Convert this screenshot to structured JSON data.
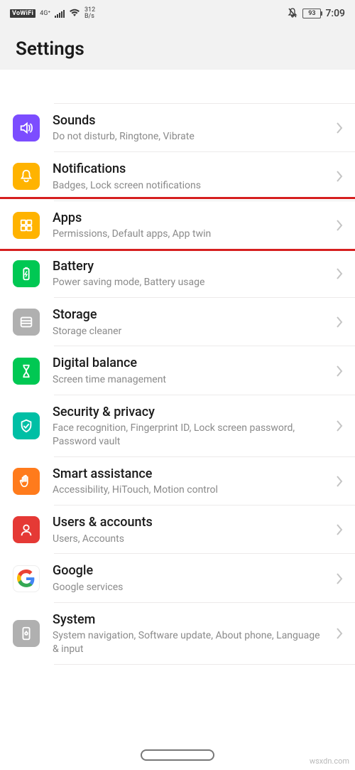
{
  "status": {
    "vowifi": "VoWiFi",
    "net_top": "4G⁺",
    "speed_top": "312",
    "speed_bottom": "B/s",
    "battery": "93",
    "time": "7:09"
  },
  "header": {
    "title": "Settings"
  },
  "rows": [
    {
      "id": "sounds",
      "title": "Sounds",
      "sub": "Do not disturb, Ringtone, Vibrate"
    },
    {
      "id": "notifications",
      "title": "Notifications",
      "sub": "Badges, Lock screen notifications"
    },
    {
      "id": "apps",
      "title": "Apps",
      "sub": "Permissions, Default apps, App twin"
    },
    {
      "id": "battery",
      "title": "Battery",
      "sub": "Power saving mode, Battery usage"
    },
    {
      "id": "storage",
      "title": "Storage",
      "sub": "Storage cleaner"
    },
    {
      "id": "digital",
      "title": "Digital balance",
      "sub": "Screen time management"
    },
    {
      "id": "security",
      "title": "Security & privacy",
      "sub": "Face recognition, Fingerprint ID, Lock screen password, Password vault"
    },
    {
      "id": "smart",
      "title": "Smart assistance",
      "sub": "Accessibility, HiTouch, Motion control"
    },
    {
      "id": "users",
      "title": "Users & accounts",
      "sub": "Users, Accounts"
    },
    {
      "id": "google",
      "title": "Google",
      "sub": "Google services"
    },
    {
      "id": "system",
      "title": "System",
      "sub": "System navigation, Software update, About phone, Language & input"
    }
  ],
  "highlight": {
    "row_id": "apps"
  },
  "watermark": "wsxdn.com"
}
